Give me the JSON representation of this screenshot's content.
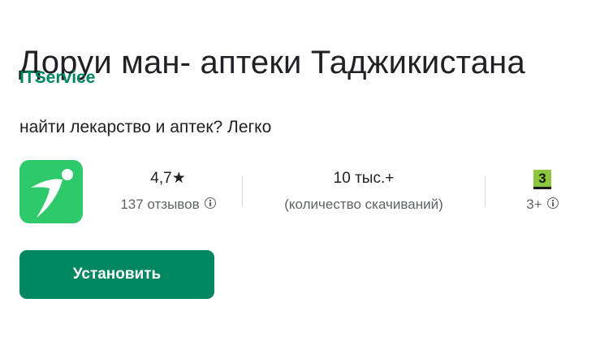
{
  "app": {
    "title": "Доруи ман- аптеки Таджикистана",
    "developer": "ITService",
    "tagline": "найти лекарство и аптек? Легко",
    "icon": "running-figure-icon"
  },
  "stats": {
    "rating": {
      "value": "4,7",
      "star": "★",
      "reviews_label": "137 отзывов"
    },
    "downloads": {
      "value": "10 тыс.+",
      "label": "(количество скачиваний)"
    },
    "content_rating": {
      "badge": "3",
      "label": "3+"
    }
  },
  "actions": {
    "install_label": "Установить"
  },
  "colors": {
    "accent": "#01875f",
    "icon_bg": "#2ec96a",
    "rating_badge": "#8cc63f",
    "text_primary": "#202124",
    "text_secondary": "#5f6368"
  }
}
